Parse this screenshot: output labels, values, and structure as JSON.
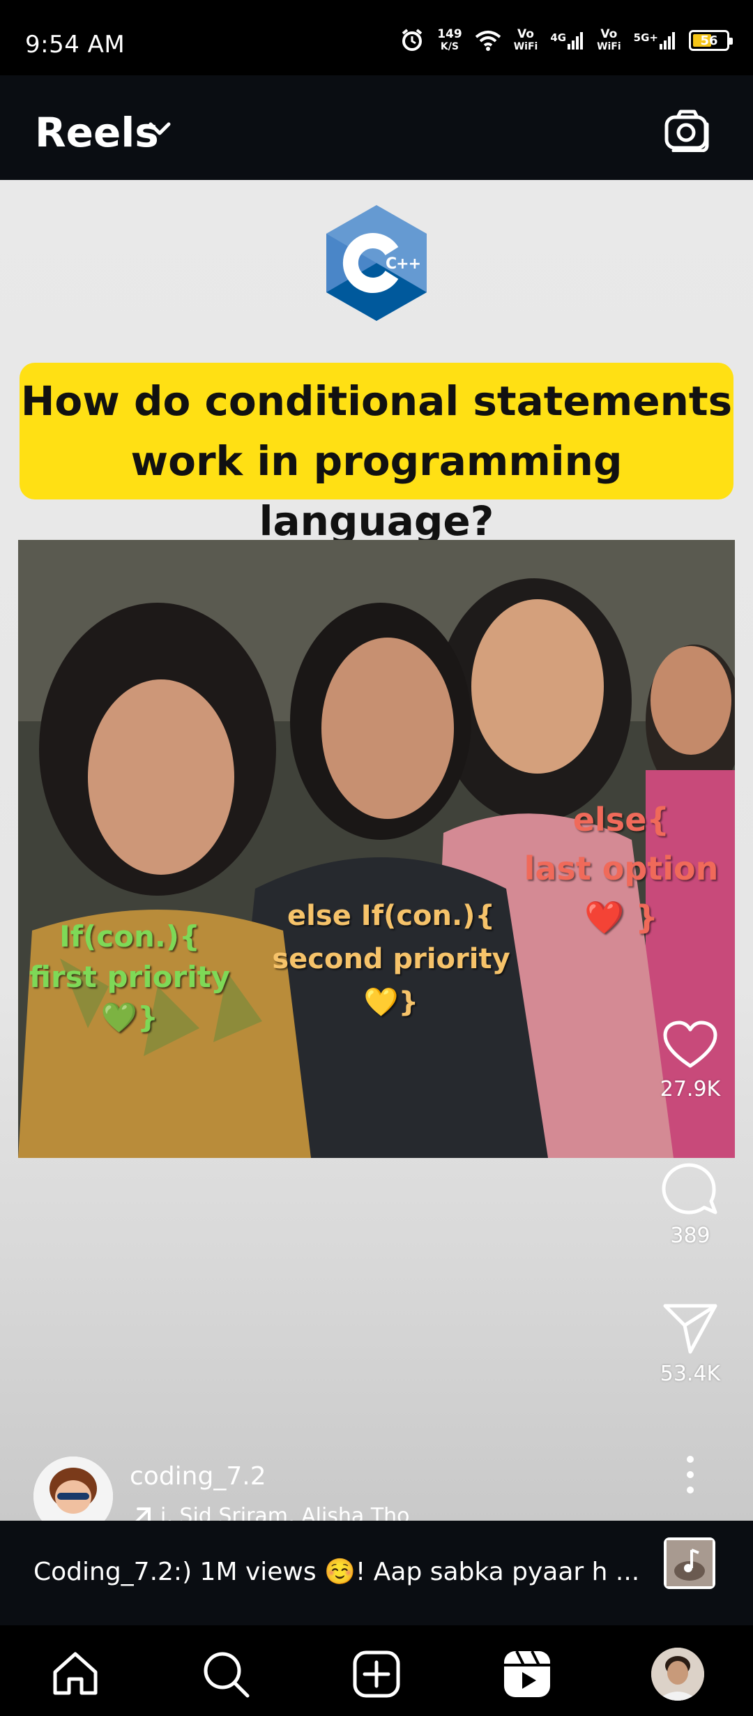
{
  "status_bar": {
    "time": "9:54 AM",
    "net_speed_top": "149",
    "net_speed_unit": "K/S",
    "vowifi1_top": "Vo",
    "vowifi1_bottom": "WiFi",
    "net4g": "4G",
    "vowifi2_top": "Vo",
    "vowifi2_bottom": "WiFi",
    "net5g": "5G+",
    "battery": "56",
    "battery_fill_percent": 56
  },
  "header": {
    "title": "Reels"
  },
  "post": {
    "question": "How do conditional statements work in programming language?",
    "overlays": {
      "if_line1": "If(con.){",
      "if_line2": "first priority",
      "if_line3": "💚}",
      "elseif_line1": "else If(con.){",
      "elseif_line2": "second priority",
      "elseif_line3": "💛}",
      "else_line1": "else{",
      "else_line2": "last option",
      "else_line3": "❤️ }"
    },
    "logo_text": "C++"
  },
  "actions": {
    "likes": "27.9K",
    "comments": "389",
    "shares": "53.4K"
  },
  "author": {
    "username": "coding_7.2",
    "audio": "i, Sid Sriram, Alisha Tho"
  },
  "caption": {
    "text": "Coding_7.2:) 1M views ☺️! Aap sabka pyaar h ..."
  },
  "colors": {
    "question_bg": "#ffe014",
    "header_bg": "#0a0d12",
    "content_bg": "#e9e9e9"
  }
}
